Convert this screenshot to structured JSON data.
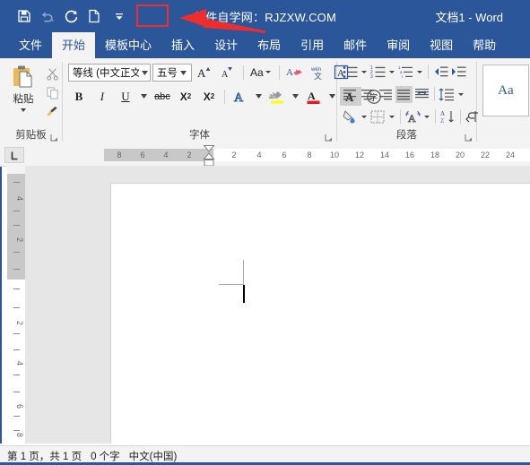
{
  "window": {
    "title_center": "软件自学网：RJZXW.COM",
    "title_right": "文档1  -  Word",
    "accent_color": "#2b579a",
    "annotation_color": "#ef2d2d"
  },
  "quick_access": {
    "items": [
      {
        "name": "save-icon",
        "tooltip": "保存"
      },
      {
        "name": "undo-icon",
        "tooltip": "撤消"
      },
      {
        "name": "redo-icon",
        "tooltip": "恢复"
      },
      {
        "name": "new-document-icon",
        "tooltip": "新建"
      },
      {
        "name": "customize-quick-access-toolbar-icon",
        "tooltip": "自定义快速访问工具栏"
      }
    ]
  },
  "tabs": [
    {
      "label": "文件",
      "active": false
    },
    {
      "label": "开始",
      "active": true
    },
    {
      "label": "模板中心",
      "active": false
    },
    {
      "label": "插入",
      "active": false
    },
    {
      "label": "设计",
      "active": false
    },
    {
      "label": "布局",
      "active": false
    },
    {
      "label": "引用",
      "active": false
    },
    {
      "label": "邮件",
      "active": false
    },
    {
      "label": "审阅",
      "active": false
    },
    {
      "label": "视图",
      "active": false
    },
    {
      "label": "帮助",
      "active": false
    }
  ],
  "ribbon": {
    "clipboard": {
      "group_label": "剪贴板",
      "paste_label": "粘贴",
      "cut_label": "剪切",
      "copy_label": "复制",
      "format_painter_label": "格式刷"
    },
    "font": {
      "group_label": "字体",
      "font_name": "等线 (中文正文",
      "font_size": "五号",
      "grow_font": "A",
      "shrink_font": "A",
      "change_case": "Aa",
      "clear_formatting": "清除所有格式",
      "phonetic_guide": "拼音指南",
      "character_border": "A",
      "bold": "B",
      "italic": "I",
      "underline": "U",
      "strikethrough": "abc",
      "subscript": "X",
      "superscript": "X",
      "text_effects": "A",
      "highlight": "ab",
      "font_color": "A",
      "character_shading": "A",
      "enclose_characters": "字"
    },
    "paragraph": {
      "group_label": "段落",
      "bullets": "项目符号",
      "numbering": "编号",
      "multilevel": "多级列表",
      "decrease_indent": "减少缩进量",
      "increase_indent": "增加缩进量",
      "align_left": "左对齐",
      "align_center": "居中",
      "align_right": "右对齐",
      "justify": "两端对齐",
      "distributed": "分散对齐",
      "line_spacing": "行和段落间距",
      "shading": "底纹",
      "borders": "边框",
      "asian_layout": "中文版式",
      "sort": "排序",
      "show_marks": "显示/隐藏编辑标记"
    },
    "styles": {
      "preview_text": "Aa"
    }
  },
  "ruler": {
    "tab_selector": "L",
    "horizontal_left": [
      "8",
      "6",
      "4",
      "2"
    ],
    "horizontal_right": [
      "2",
      "4",
      "6",
      "8",
      "10",
      "12",
      "14",
      "16",
      "18",
      "20",
      "22",
      "24"
    ],
    "vertical_gray": [
      "4",
      "2"
    ],
    "vertical_white": [
      "2",
      "4",
      "6",
      "8"
    ]
  },
  "document": {
    "page_background": "#ffffff",
    "canvas_background": "#e6e6e6"
  },
  "status_bar": {
    "page_info": "第 1 页，共 1 页",
    "word_count": "0 个字",
    "language": "中文(中国)"
  }
}
